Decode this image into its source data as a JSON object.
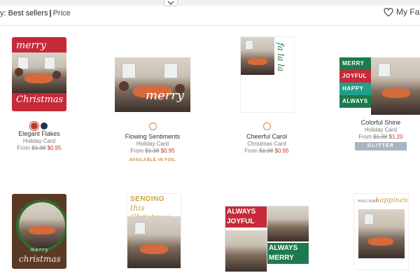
{
  "toolbar": {
    "sort_prefix": "y:",
    "sort_value": "Best sellers",
    "sort_option": "Price",
    "favorites_label": "My Favo"
  },
  "cards": [
    {
      "name": "Elegant Flakes",
      "type": "Holiday Card",
      "price_from": "From",
      "old_price": "$1.38",
      "new_price": "$0.95",
      "thumb_text": [
        "merry",
        "Christmas"
      ],
      "swatches": [
        "#c0392b",
        "#1f3556"
      ]
    },
    {
      "name": "Flowing Sentiments",
      "type": "Holiday Card",
      "price_from": "From",
      "old_price": "$1.38",
      "new_price": "$0.95",
      "badge": "AVAILABLE IN FOIL",
      "thumb_text": [
        "merry"
      ]
    },
    {
      "name": "Cheerful Carol",
      "type": "Christmas Card",
      "price_from": "From",
      "old_price": "$1.38",
      "new_price": "$0.95",
      "thumb_text": [
        "fa la la"
      ]
    },
    {
      "name": "Colorful Shine",
      "type": "Holiday Card",
      "price_from": "From",
      "old_price": "$1.38",
      "new_price": "$1.20",
      "badge": "GLITTER",
      "thumb_text": [
        "MERRY",
        "JOYFUL",
        "HAPPY",
        "ALWAYS"
      ]
    },
    {
      "thumb_text": [
        "merry",
        "christmas"
      ]
    },
    {
      "thumb_text": [
        "SENDING",
        "this Christmas"
      ]
    },
    {
      "thumb_text": [
        "ALWAYS",
        "JOYFUL",
        "ALWAYS",
        "MERRY"
      ]
    },
    {
      "thumb_text": [
        "HOLIDAY",
        "happiness"
      ]
    }
  ],
  "colors": {
    "sale": "#c0392b",
    "foil": "#c48a3a",
    "glitter": "#a9b4c4"
  }
}
